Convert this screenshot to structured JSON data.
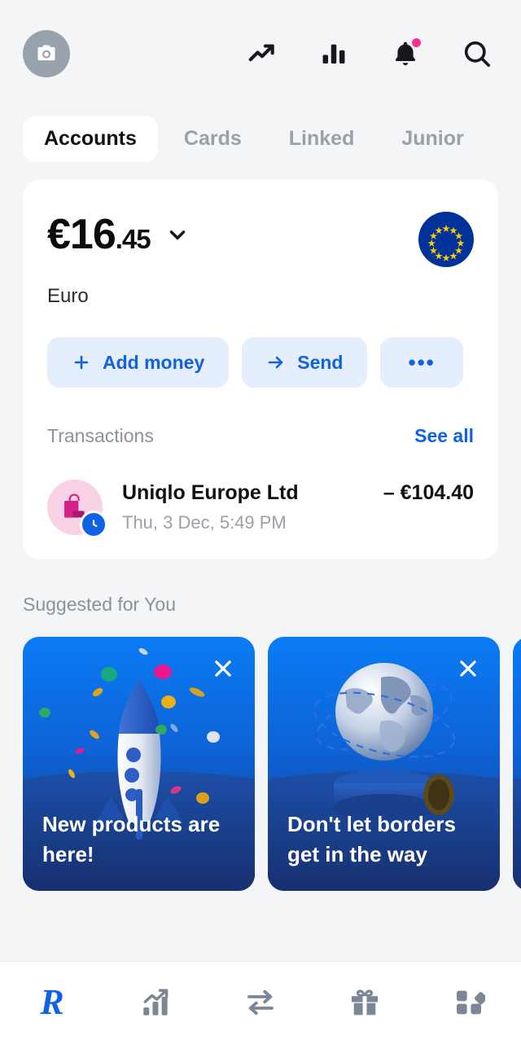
{
  "header": {
    "avatar_icon": "camera-icon",
    "icons": [
      {
        "name": "trending-up-icon",
        "label": "Trends"
      },
      {
        "name": "bar-chart-icon",
        "label": "Analytics"
      },
      {
        "name": "bell-icon",
        "label": "Notifications",
        "has_dot": true
      },
      {
        "name": "search-icon",
        "label": "Search"
      }
    ]
  },
  "tabs": [
    {
      "label": "Accounts",
      "active": true
    },
    {
      "label": "Cards",
      "active": false
    },
    {
      "label": "Linked",
      "active": false
    },
    {
      "label": "Junior",
      "active": false
    }
  ],
  "account": {
    "currency_symbol": "€",
    "balance_whole": "€16",
    "balance_cents": ".45",
    "balance_full": "€16.45",
    "currency_name": "Euro",
    "flag_icon": "eu-flag-icon",
    "chevron_icon": "chevron-down-icon",
    "actions": [
      {
        "label": "Add money",
        "icon": "plus-icon"
      },
      {
        "label": "Send",
        "icon": "arrow-right-icon"
      },
      {
        "label": "•••",
        "icon": "more-horizontal-icon"
      }
    ]
  },
  "transactions": {
    "title": "Transactions",
    "see_all": "See all",
    "items": [
      {
        "merchant": "Uniqlo Europe Ltd",
        "date": "Thu, 3 Dec, 5:49 PM",
        "amount": "– €104.40",
        "icon": "shopping-bag-icon",
        "badge_icon": "clock-icon"
      }
    ]
  },
  "suggested": {
    "title": "Suggested for You",
    "cards": [
      {
        "text": "New products are here!",
        "art": "rocket-illustration",
        "close_icon": "close-icon"
      },
      {
        "text": "Don't let borders get in the way",
        "art": "globe-illustration",
        "close_icon": "close-icon"
      },
      {
        "text": "",
        "art": "partial-card",
        "close_icon": "close-icon"
      }
    ]
  },
  "bottom_nav": [
    {
      "name": "home",
      "icon": "revolut-logo-icon",
      "label": "R",
      "active": true
    },
    {
      "name": "analytics",
      "icon": "chart-growth-icon",
      "label": "",
      "active": false
    },
    {
      "name": "transfers",
      "icon": "transfer-arrows-icon",
      "label": "",
      "active": false
    },
    {
      "name": "rewards",
      "icon": "gift-icon",
      "label": "",
      "active": false
    },
    {
      "name": "more",
      "icon": "grid-icon",
      "label": "",
      "active": false
    }
  ],
  "colors": {
    "background": "#f4f5f7",
    "card": "#ffffff",
    "accent_blue": "#0f62e6",
    "pill_bg": "#e5eefc",
    "muted_text": "#8b929c",
    "notification_dot": "#f5308f",
    "eu_blue": "#003399",
    "eu_star": "#ffcc00"
  }
}
